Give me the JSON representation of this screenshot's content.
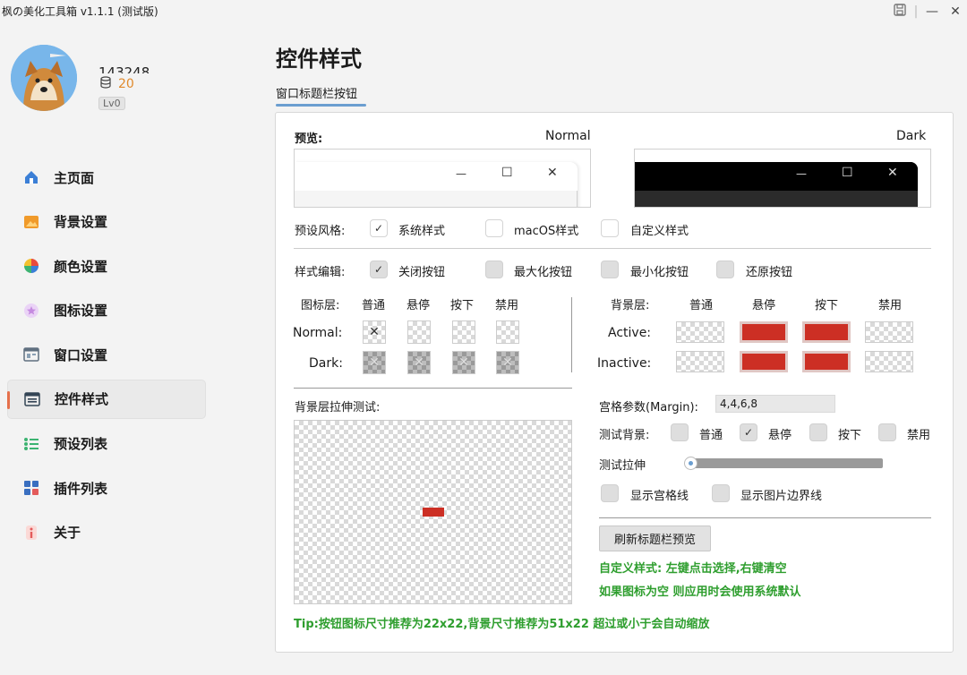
{
  "titlebar": {
    "title": "枫の美化工具箱 v1.1.1 (测试版)",
    "save_icon": "💾",
    "minimize": "—",
    "close": "✕"
  },
  "user": {
    "uid": "143248",
    "coins": "20",
    "level": "Lv0"
  },
  "sidebar": {
    "items": [
      {
        "label": "主页面",
        "icon": "home-icon",
        "color": "#3b7fd6"
      },
      {
        "label": "背景设置",
        "icon": "image-icon",
        "color": "#f09a2a"
      },
      {
        "label": "颜色设置",
        "icon": "palette-icon",
        "color": "#e84b3c"
      },
      {
        "label": "图标设置",
        "icon": "star-icon",
        "color": "#c58be0"
      },
      {
        "label": "窗口设置",
        "icon": "window-icon",
        "color": "#607080"
      },
      {
        "label": "控件样式",
        "icon": "widget-icon",
        "color": "#334455"
      },
      {
        "label": "预设列表",
        "icon": "list-icon",
        "color": "#3cb371"
      },
      {
        "label": "插件列表",
        "icon": "grid-icon",
        "color": "#3a6fc0"
      },
      {
        "label": "关于",
        "icon": "info-icon",
        "color": "#e35b5b"
      }
    ],
    "active_index": 5
  },
  "main": {
    "title": "控件样式",
    "tab": "窗口标题栏按钮",
    "preview": {
      "label": "预览:",
      "normal": "Normal",
      "dark": "Dark"
    },
    "preset": {
      "label": "预设风格:",
      "options": [
        "系统样式",
        "macOS样式",
        "自定义样式"
      ],
      "checked": [
        true,
        false,
        false
      ]
    },
    "edit": {
      "label": "样式编辑:",
      "options": [
        "关闭按钮",
        "最大化按钮",
        "最小化按钮",
        "还原按钮"
      ],
      "checked": [
        true,
        false,
        false,
        false
      ]
    },
    "icon_layer": {
      "label": "图标层:",
      "cols": [
        "普通",
        "悬停",
        "按下",
        "禁用"
      ],
      "rows": [
        "Normal:",
        "Dark:"
      ]
    },
    "bg_layer": {
      "label": "背景层:",
      "cols": [
        "普通",
        "悬停",
        "按下",
        "禁用"
      ],
      "rows": [
        "Active:",
        "Inactive:"
      ]
    },
    "stretch_test_label": "背景层拉伸测试:",
    "margin": {
      "label": "宫格参数(Margin):",
      "value": "4,4,6,8"
    },
    "test_bg": {
      "label": "测试背景:",
      "options": [
        "普通",
        "悬停",
        "按下",
        "禁用"
      ],
      "checked": [
        false,
        true,
        false,
        false
      ]
    },
    "test_stretch": {
      "label": "测试拉伸",
      "value": 0
    },
    "show_grid": "显示宫格线",
    "show_border": "显示图片边界线",
    "refresh_button": "刷新标题栏预览",
    "hint1": "自定义样式: 左键点击选择,右键清空",
    "hint2": "如果图标为空 则应用时会使用系统默认",
    "tip": "Tip:按钮图标尺寸推荐为22x22,背景尺寸推荐为51x22 超过或小于会自动缩放",
    "glyphs": {
      "minimize": "—",
      "maximize": "☐",
      "close": "✕",
      "check": "✓"
    }
  }
}
